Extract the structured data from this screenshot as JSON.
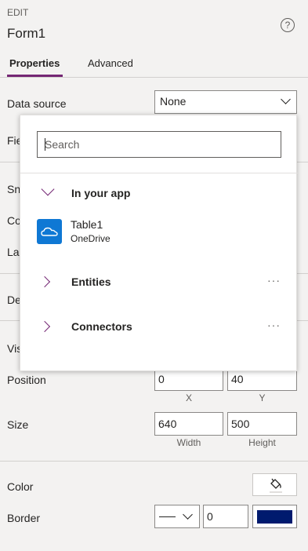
{
  "header": {
    "caption": "EDIT",
    "title": "Form1",
    "help_glyph": "?"
  },
  "tabs": [
    {
      "label": "Properties",
      "active": true
    },
    {
      "label": "Advanced",
      "active": false
    }
  ],
  "properties": {
    "data_source": {
      "label": "Data source",
      "value": "None"
    },
    "fields_label_partial": "Fie",
    "snap_label_partial": "Sn",
    "columns_label_partial": "Co",
    "layout_label_partial": "La",
    "default_label_partial": "De",
    "visible_label_partial": "Vis",
    "position": {
      "label": "Position",
      "x": "0",
      "y": "40",
      "x_caption": "X",
      "y_caption": "Y"
    },
    "size": {
      "label": "Size",
      "width": "640",
      "height": "500",
      "width_caption": "Width",
      "height_caption": "Height"
    },
    "color": {
      "label": "Color",
      "icon": "paint-bucket-icon"
    },
    "border": {
      "label": "Border",
      "thickness": "0",
      "color": "#001a6e"
    }
  },
  "dropdown": {
    "search_placeholder": "Search",
    "in_your_app": {
      "label": "In your app"
    },
    "items": [
      {
        "name": "Table1",
        "sub": "OneDrive",
        "icon": "onedrive-icon",
        "color": "#0f78d4"
      }
    ],
    "entities": {
      "label": "Entities",
      "more": "···"
    },
    "connectors": {
      "label": "Connectors",
      "more": "···"
    }
  },
  "colors": {
    "accent": "#742774",
    "background": "#f3f2f1"
  }
}
